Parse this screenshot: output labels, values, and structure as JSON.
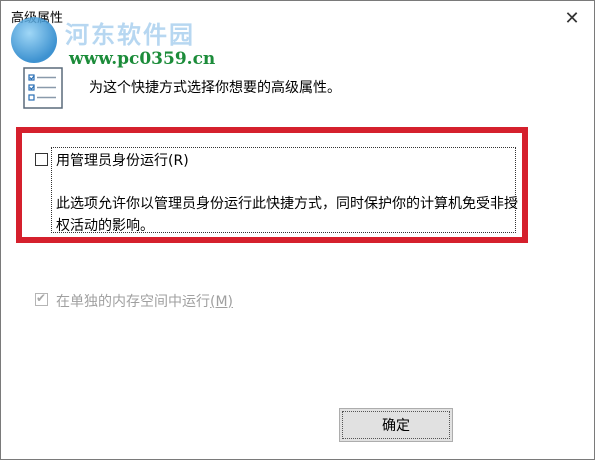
{
  "window": {
    "title": "高级属性",
    "close_symbol": "✕"
  },
  "watermark": {
    "line1": "河东软件园",
    "line2": "www.pc0359.cn"
  },
  "header": {
    "text": "为这个快捷方式选择你想要的高级属性。"
  },
  "options": {
    "run_as_admin": {
      "label": "用管理员身份运行",
      "access_key": "(R)",
      "checked": false,
      "description": "此选项允许你以管理员身份运行此快捷方式，同时保护你的计算机免受非授权活动的影响。"
    },
    "separate_memory": {
      "label": "在单独的内存空间中运行",
      "access_key": "(M)",
      "checked": true,
      "enabled": false
    }
  },
  "buttons": {
    "ok": "确定"
  },
  "colors": {
    "highlight_frame": "#d5202d",
    "disabled_text": "#a0a0a0",
    "button_bg": "#e1e1e1"
  }
}
